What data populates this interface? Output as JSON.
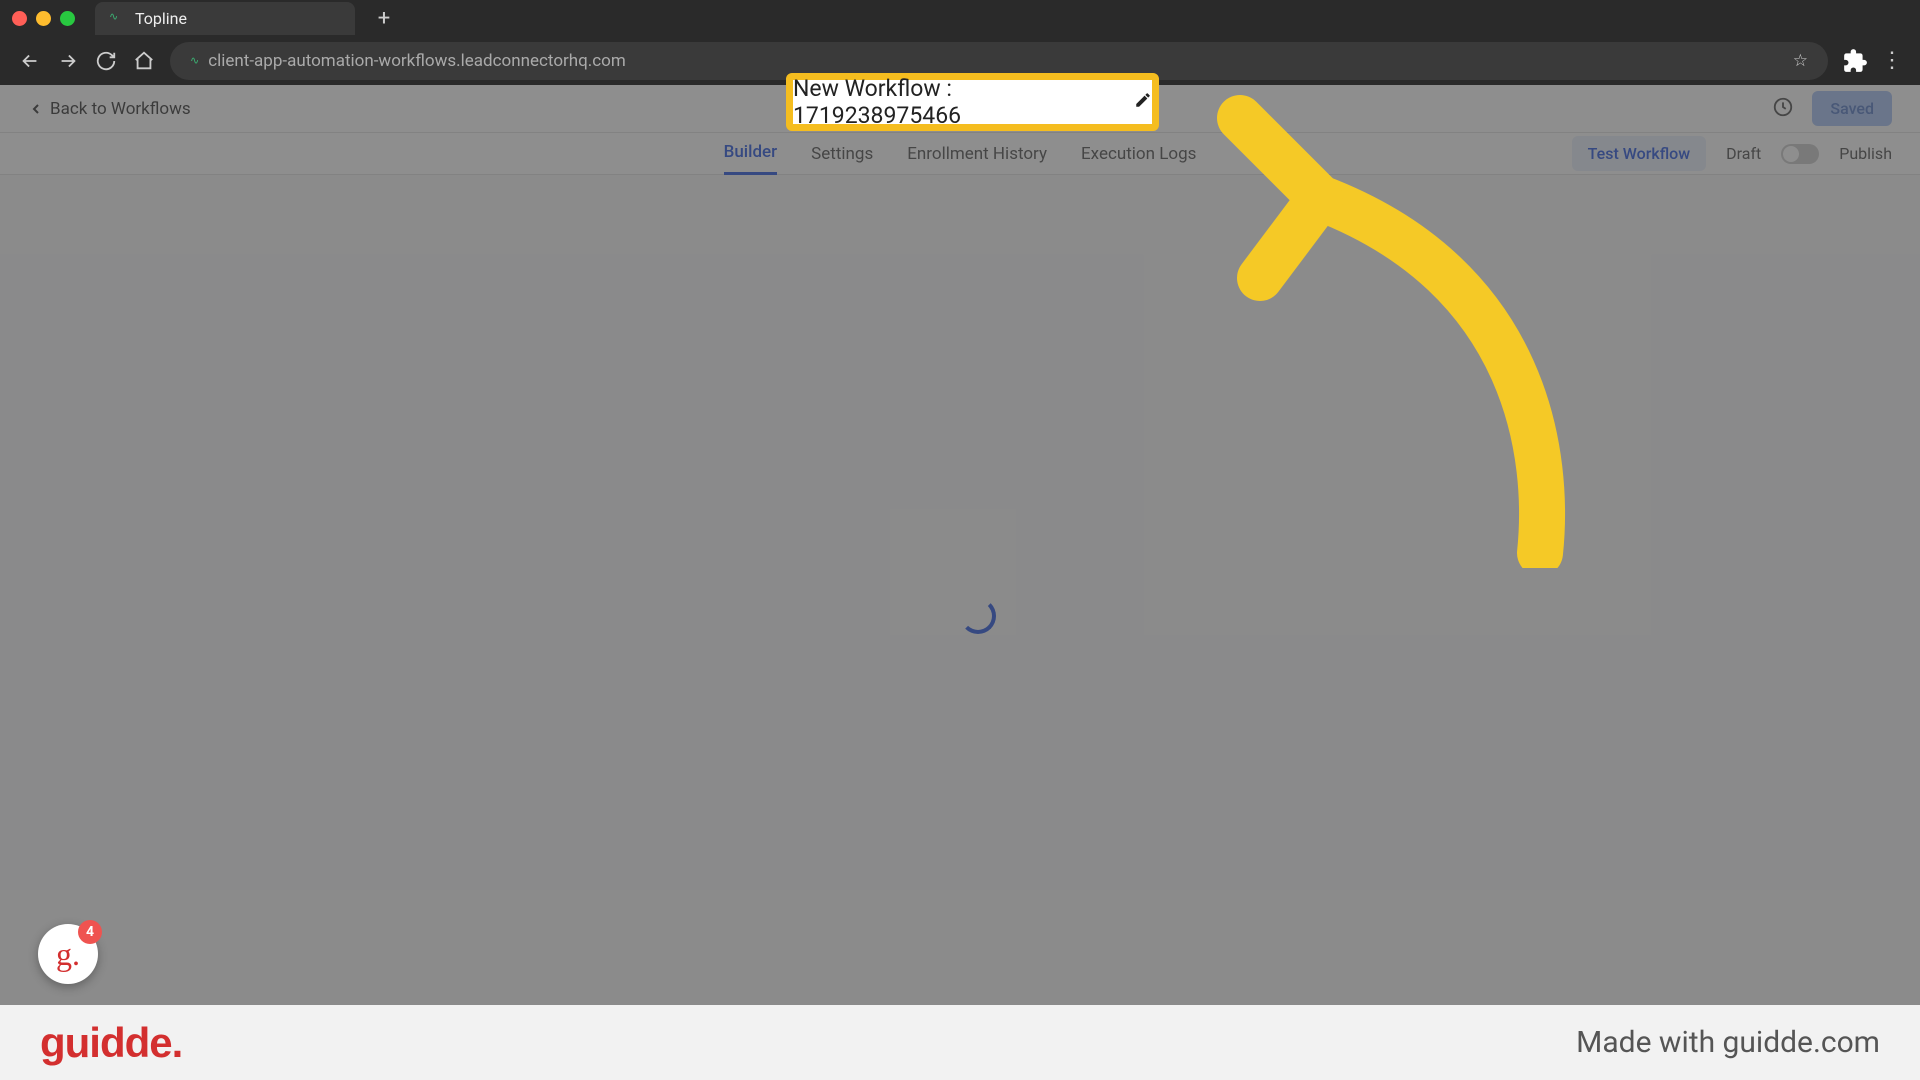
{
  "browser": {
    "tab_title": "Topline",
    "url": "client-app-automation-workflows.leadconnectorhq.com"
  },
  "header": {
    "back_label": "Back to Workflows",
    "workflow_title": "New Workflow : 1719238975466",
    "saved_button": "Saved"
  },
  "tabs": {
    "builder": "Builder",
    "settings": "Settings",
    "enrollment": "Enrollment History",
    "execution": "Execution Logs",
    "test": "Test Workflow",
    "draft": "Draft",
    "publish": "Publish"
  },
  "help": {
    "badge_count": "4"
  },
  "footer": {
    "logo": "guidde.",
    "made_with": "Made with guidde.com"
  }
}
